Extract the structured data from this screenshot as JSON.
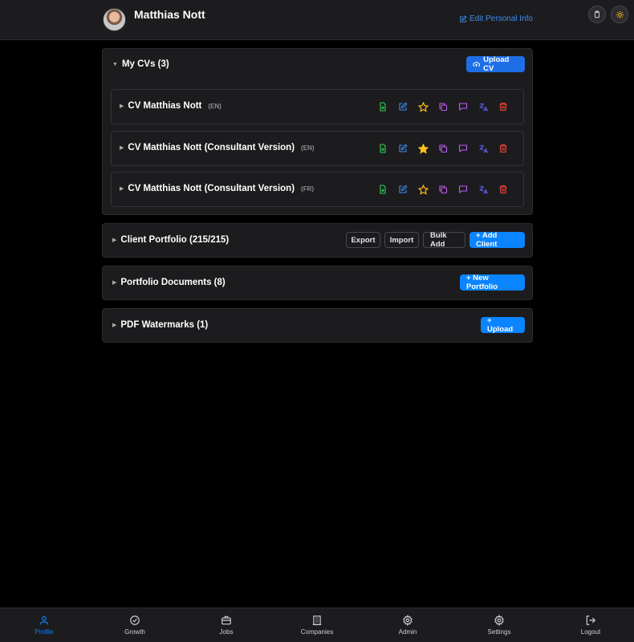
{
  "header": {
    "user_name": "Matthias Nott",
    "edit_link": "Edit Personal Info"
  },
  "cvs": {
    "title": "My CVs (3)",
    "upload_label": "Upload CV",
    "items": [
      {
        "name": "CV Matthias Nott",
        "lang": "(EN)",
        "starred": false
      },
      {
        "name": "CV Matthias Nott (Consultant Version)",
        "lang": "(EN)",
        "starred": true
      },
      {
        "name": "CV Matthias Nott (Consultant Version)",
        "lang": "(FR)",
        "starred": false
      }
    ]
  },
  "client_portfolio": {
    "title": "Client Portfolio (215/215)",
    "export_label": "Export",
    "import_label": "Import",
    "bulk_add_label": "Bulk Add",
    "add_client_label": "+ Add Client"
  },
  "portfolio_documents": {
    "title": "Portfolio Documents (8)",
    "new_portfolio_label": "+ New Portfolio"
  },
  "pdf_watermarks": {
    "title": "PDF Watermarks (1)",
    "upload_label": "+ Upload"
  },
  "nav": {
    "items": [
      {
        "label": "Profile",
        "icon": "user-icon",
        "active": true
      },
      {
        "label": "Growth",
        "icon": "check-circle-icon",
        "active": false
      },
      {
        "label": "Jobs",
        "icon": "briefcase-icon",
        "active": false
      },
      {
        "label": "Companies",
        "icon": "building-icon",
        "active": false
      },
      {
        "label": "Admin",
        "icon": "gear-icon",
        "active": false
      },
      {
        "label": "Settings",
        "icon": "gear-icon",
        "active": false
      },
      {
        "label": "Logout",
        "icon": "logout-icon",
        "active": false
      }
    ]
  },
  "colors": {
    "accent": "#0a84ff",
    "green": "#30d158",
    "blue": "#3b8cf0",
    "gold": "#ffc01e",
    "purple": "#bf5af2",
    "indigo": "#5e5ce6",
    "red": "#ff453a"
  }
}
